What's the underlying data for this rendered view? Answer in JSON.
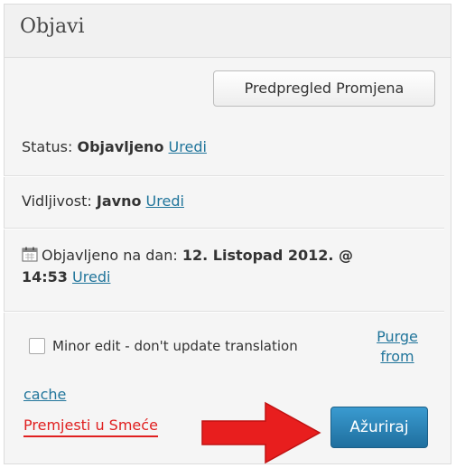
{
  "box": {
    "title": "Objavi"
  },
  "preview_button": "Predpregled Promjena",
  "status": {
    "label": "Status:",
    "value": "Objavljeno",
    "link": "Uredi"
  },
  "visibility": {
    "label": "Vidljivost:",
    "value": "Javno",
    "link": "Uredi"
  },
  "published": {
    "label": "Objavljeno na dan:",
    "value_line1": "12. Listopad 2012. @",
    "value_line2": "14:53",
    "link": "Uredi"
  },
  "minor_edit": {
    "label": "Minor edit - don't update translation",
    "checked": false
  },
  "purge": {
    "line1": "Purge",
    "line2": "from",
    "line3": "cache"
  },
  "trash_link": "Premjesti u Smeće",
  "update_button": "Ažuriraj",
  "colors": {
    "accent": "#21759b",
    "primary_button": "#2a86bd",
    "trash": "#e02020",
    "arrow": "#e81e1e"
  },
  "icons": {
    "calendar": "calendar-icon",
    "arrow": "red-arrow-annotation"
  }
}
